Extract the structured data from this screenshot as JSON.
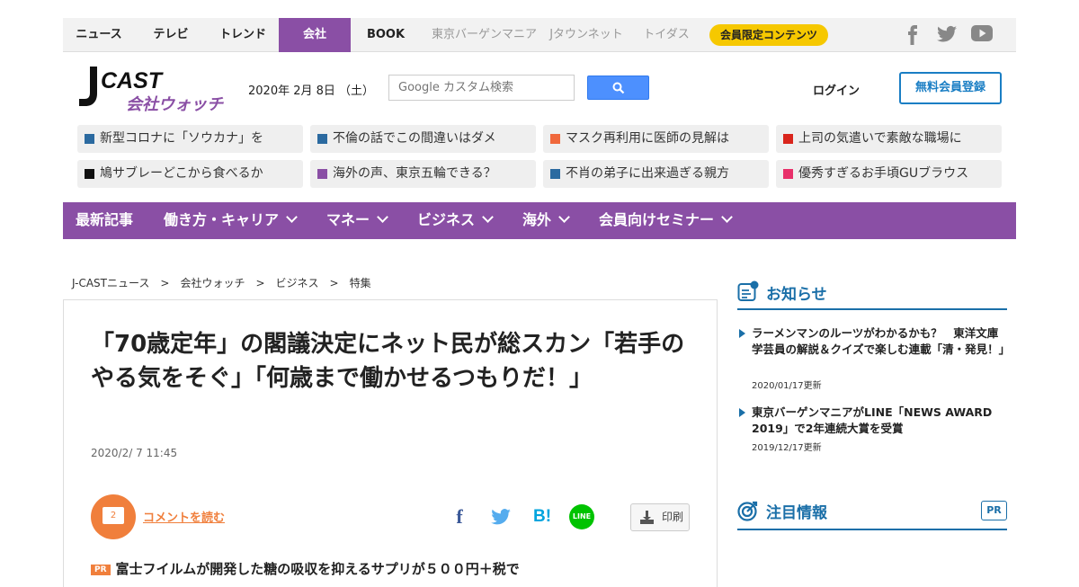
{
  "top_nav": {
    "items": [
      "ニュース",
      "テレビ",
      "トレンド",
      "会社",
      "BOOK"
    ],
    "external": [
      "東京バーゲンマニア",
      "Jタウンネット",
      "トイダス"
    ],
    "member": "会員限定コンテンツ",
    "active": "会社"
  },
  "header": {
    "logo_main": "CAST",
    "logo_j": "J",
    "logo_sub": "会社ウォッチ",
    "date": "2020年 2月 8日 （土）",
    "search_placeholder": "Google カスタム検索",
    "login": "ログイン",
    "register": "無料会員登録"
  },
  "hot_topics": [
    {
      "text": "新型コロナに「ソウカナ」を",
      "color": "#2b6aa0"
    },
    {
      "text": "不倫の話でこの間違いはダメ",
      "color": "#2b6aa0"
    },
    {
      "text": "マスク再利用に医師の見解は",
      "color": "#f0683c"
    },
    {
      "text": "上司の気遣いで素敵な職場に",
      "color": "#d9251c"
    },
    {
      "text": "鳩サブレーどこから食べるか",
      "color": "#111111"
    },
    {
      "text": "海外の声、東京五輪できる？",
      "color": "#8a4fa5"
    },
    {
      "text": "不肖の弟子に出来過ぎる親方",
      "color": "#2b6aa0"
    },
    {
      "text": "優秀すぎるお手頃GUブラウス",
      "color": "#e8306a"
    }
  ],
  "category_nav": [
    "最新記事",
    "働き方・キャリア",
    "マネー",
    "ビジネス",
    "海外",
    "会員向けセミナー"
  ],
  "breadcrumb": [
    "J-CASTニュース",
    "会社ウォッチ",
    "ビジネス",
    "特集"
  ],
  "breadcrumb_sep": ">",
  "article": {
    "title": "「70歳定年」の閣議決定にネット民が総スカン「若手のやる気をそぐ」「何歳まで働かせるつもりだ！」",
    "date": "2020/2/ 7 11:45",
    "comment_count": "2",
    "comment_link": "コメントを読む",
    "print": "印刷",
    "pr_label": "PR",
    "pr_text": "富士フイルムが開発した糖の吸収を抑えるサプリが５００円＋税で"
  },
  "share": {
    "facebook": "f",
    "twitter": "twitter",
    "hatena": "B!",
    "line": "LINE"
  },
  "sidebar": {
    "notice_title": "お知らせ",
    "notices": [
      {
        "text": "ラーメンマンのルーツがわかるかも？　東洋文庫学芸員の解説＆クイズで楽しむ連載「清・発見！」",
        "date": "2020/01/17更新"
      },
      {
        "text": "東京バーゲンマニアがLINE「NEWS AWARD 2019」で2年連続大賞を受賞",
        "date": "2019/12/17更新"
      }
    ],
    "featured_title": "注目情報",
    "featured_badge": "PR"
  },
  "colors": {
    "purple": "#8a4fa5",
    "blue": "#1a6fa8",
    "orange": "#f07f3c",
    "yellow": "#f6c800"
  }
}
